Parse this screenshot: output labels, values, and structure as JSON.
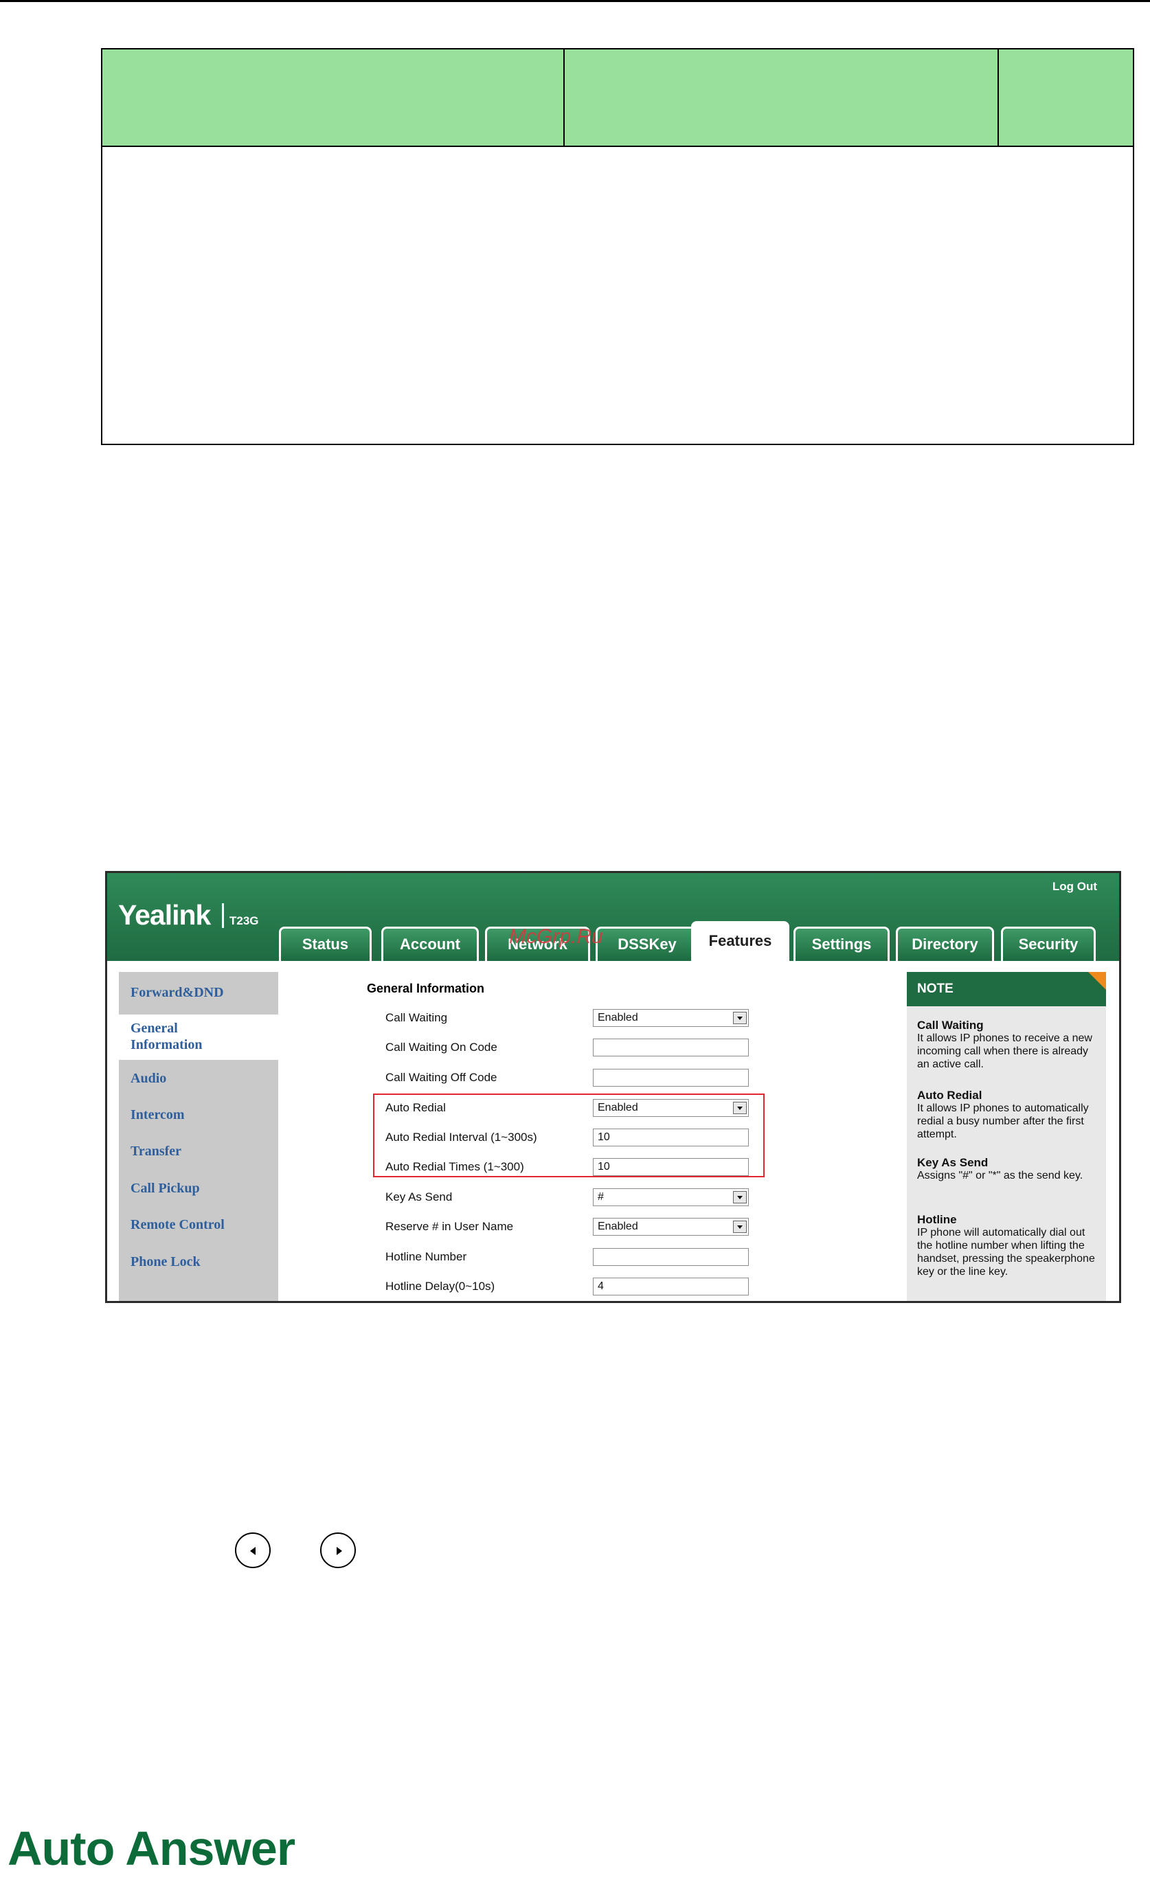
{
  "screenshot": {
    "brand": "Yealink",
    "model": "T23G",
    "logout_label": "Log Out",
    "watermark": "McGrp.Ru",
    "tabs": [
      "Status",
      "Account",
      "Network",
      "DSSKey",
      "Features",
      "Settings",
      "Directory",
      "Security"
    ],
    "active_tab": "Features",
    "left_nav": [
      "Forward&DND",
      "General Information",
      "Audio",
      "Intercom",
      "Transfer",
      "Call Pickup",
      "Remote Control",
      "Phone Lock"
    ],
    "active_nav": "General Information",
    "section_title": "General Information",
    "rows": [
      {
        "label": "Call Waiting",
        "value": "Enabled",
        "type": "select"
      },
      {
        "label": "Call Waiting On Code",
        "value": "",
        "type": "text"
      },
      {
        "label": "Call Waiting Off Code",
        "value": "",
        "type": "text"
      },
      {
        "label": "Auto Redial",
        "value": "Enabled",
        "type": "select"
      },
      {
        "label": "Auto Redial Interval (1~300s)",
        "value": "10",
        "type": "text"
      },
      {
        "label": "Auto Redial Times (1~300)",
        "value": "10",
        "type": "text"
      },
      {
        "label": "Key As Send",
        "value": "#",
        "type": "select"
      },
      {
        "label": "Reserve # in User Name",
        "value": "Enabled",
        "type": "select"
      },
      {
        "label": "Hotline Number",
        "value": "",
        "type": "text"
      },
      {
        "label": "Hotline Delay(0~10s)",
        "value": "4",
        "type": "text"
      }
    ],
    "note": {
      "heading": "NOTE",
      "entries": [
        {
          "title": "Call Waiting",
          "text": "It allows IP phones to receive a new incoming call when there is already an active call."
        },
        {
          "title": "Auto Redial",
          "text": "It allows IP phones to automatically redial a busy number after the first attempt."
        },
        {
          "title": "Key As Send",
          "text": "Assigns \"#\" or \"*\" as the send key."
        },
        {
          "title": "Hotline",
          "text": "IP phone will automatically dial out the hotline number when lifting the handset, pressing the speakerphone key or the line key."
        }
      ]
    }
  },
  "icons": {
    "left_key": "left-navigation-key-icon",
    "right_key": "right-navigation-key-icon"
  },
  "heading": "Auto Answer",
  "colors": {
    "table_header": "#99e09a",
    "yealink_green": "#1f6b42",
    "heading_green": "#0d6b39",
    "highlight_red": "#e2262c"
  }
}
